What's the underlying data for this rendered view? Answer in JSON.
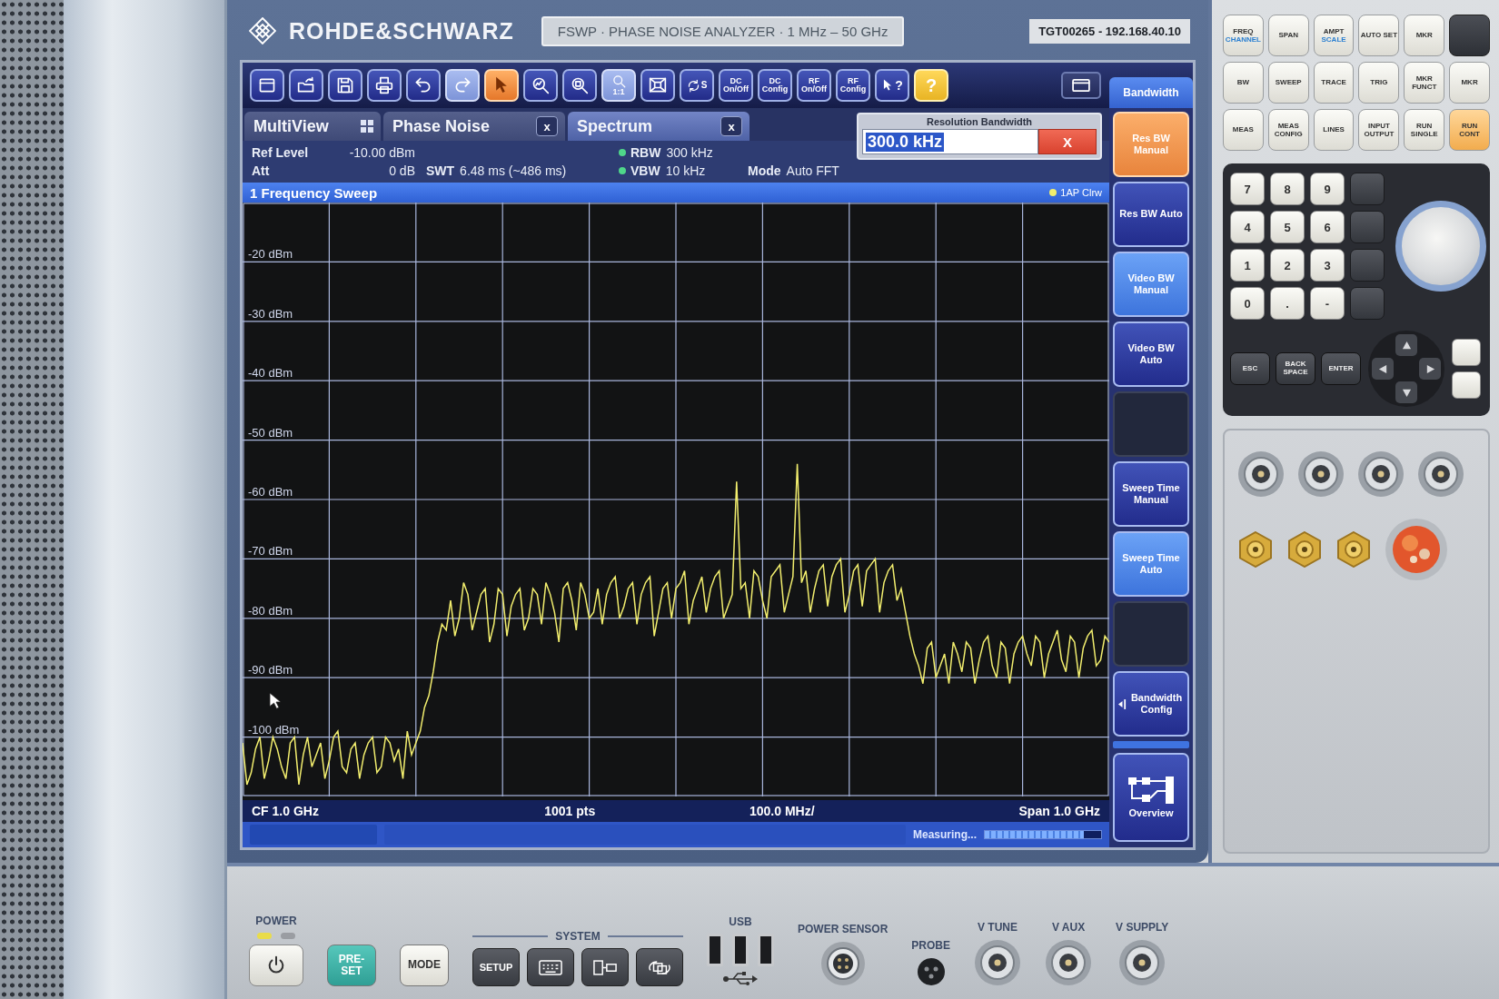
{
  "instrument": {
    "brand": "ROHDE&SCHWARZ",
    "model": "FSWP · PHASE NOISE ANALYZER · 1 MHz – 50 GHz",
    "device_id": "TGT00265 - 192.168.40.10"
  },
  "toolbar": [
    {
      "kind": "window",
      "selected": false,
      "disabled": false
    },
    {
      "kind": "open",
      "selected": false,
      "disabled": false
    },
    {
      "kind": "save",
      "selected": false,
      "disabled": false
    },
    {
      "kind": "print",
      "selected": false,
      "disabled": false
    },
    {
      "kind": "undo",
      "selected": false,
      "disabled": false
    },
    {
      "kind": "redo",
      "selected": false,
      "disabled": true
    },
    {
      "kind": "pointer",
      "selected": true,
      "disabled": false
    },
    {
      "kind": "zoom",
      "selected": false,
      "disabled": false
    },
    {
      "kind": "multizoom",
      "selected": false,
      "disabled": false
    },
    {
      "kind": "zoom-off",
      "label": "1:1",
      "selected": false,
      "disabled": true
    },
    {
      "kind": "display",
      "selected": false,
      "disabled": false
    },
    {
      "kind": "sequencer",
      "label": "S",
      "selected": false,
      "disabled": false
    },
    {
      "kind": "text",
      "label": "DC On/Off",
      "selected": false,
      "disabled": false
    },
    {
      "kind": "text",
      "label": "DC Config",
      "selected": false,
      "disabled": false
    },
    {
      "kind": "text",
      "label": "RF On/Off",
      "selected": false,
      "disabled": false
    },
    {
      "kind": "text",
      "label": "RF Config",
      "selected": false,
      "disabled": false
    },
    {
      "kind": "whatsthis",
      "label": "?",
      "selected": false,
      "disabled": false
    },
    {
      "kind": "help",
      "label": "?",
      "selected": false,
      "disabled": false
    }
  ],
  "menu": {
    "title": "Bandwidth"
  },
  "tabs": [
    {
      "kind": "multiview",
      "label": "MultiView",
      "selected": false
    },
    {
      "kind": "channel",
      "label": "Phase Noise",
      "close": "x",
      "selected": false
    },
    {
      "kind": "channel",
      "label": "Spectrum",
      "close": "x",
      "selected": true
    }
  ],
  "dialog": {
    "title": "Resolution Bandwidth",
    "value": "300.0 kHz",
    "selected": true,
    "close": "X"
  },
  "settings": [
    {
      "label": "Ref Level",
      "value": "-10.00 dBm",
      "dot": false
    },
    {
      "label": "RBW",
      "value": "300 kHz",
      "dot": true
    },
    {
      "label": "Att",
      "value": "0 dB",
      "dot": false
    },
    {
      "label": "SWT",
      "value": "6.48 ms (~486 ms)",
      "dot": false
    },
    {
      "label": "VBW",
      "value": "10 kHz",
      "dot": true
    },
    {
      "label": "Mode",
      "value": "Auto FFT",
      "dot": false
    }
  ],
  "diagram": {
    "chart_data": {
      "type": "line",
      "title": "1 Frequency Sweep",
      "grid": true,
      "categories": [
        null,
        null,
        null,
        null,
        null,
        null,
        null,
        null,
        null,
        null,
        null,
        null,
        null,
        null,
        null,
        null,
        null,
        null,
        null,
        null,
        null,
        null,
        null,
        null,
        null,
        null,
        null,
        null,
        null,
        null,
        null,
        null,
        null,
        null,
        null,
        null,
        null,
        null,
        null,
        null,
        null,
        null,
        null,
        null,
        null,
        null,
        null,
        null,
        null,
        null,
        null,
        null,
        null,
        null,
        null,
        null,
        null,
        null,
        null,
        null,
        null,
        null,
        null,
        null,
        null,
        null,
        null,
        null,
        null,
        null,
        null,
        null,
        null,
        null,
        null,
        null,
        null,
        null,
        null,
        null,
        null,
        null,
        null,
        null,
        null,
        null,
        null,
        null,
        null,
        null,
        null,
        null,
        null,
        null,
        null,
        null,
        null,
        null,
        null,
        null,
        null,
        null,
        null,
        null,
        null,
        null,
        null,
        null,
        null,
        null,
        null,
        null,
        null,
        null,
        null,
        null,
        null,
        null,
        null,
        null,
        null,
        null,
        null,
        null,
        null,
        null,
        null,
        null,
        null,
        null,
        null,
        null,
        null,
        null,
        null,
        null,
        null,
        null,
        null,
        null,
        null,
        null,
        null,
        null,
        null,
        null,
        null,
        null,
        null,
        null,
        null,
        null,
        null,
        null,
        null,
        null,
        null,
        null,
        null,
        null,
        null,
        null,
        null,
        null,
        null,
        null,
        null,
        null,
        null,
        null,
        null,
        null,
        null,
        null,
        null,
        null,
        null,
        null,
        null,
        null,
        null,
        null,
        null,
        null,
        null,
        null,
        null,
        null,
        null,
        null,
        null,
        null,
        null,
        null,
        null,
        null,
        null,
        null,
        null,
        null,
        null
      ],
      "series": [
        {
          "name": "1AP Clrw",
          "color": "#f2ee6e",
          "values": [
            -101,
            -108,
            -106,
            -102,
            -100,
            -107,
            -104,
            -100,
            -102,
            -105,
            -107,
            -101,
            -100,
            -108,
            -103,
            -100,
            -105,
            -103,
            -101,
            -107,
            -104,
            -100,
            -99,
            -105,
            -106,
            -102,
            -101,
            -107,
            -103,
            -101,
            -100,
            -106,
            -105,
            -100,
            -101,
            -104,
            -102,
            -107,
            -99,
            -103,
            -101,
            -99,
            -95,
            -93,
            -89,
            -84,
            -81,
            -82,
            -77,
            -83,
            -80,
            -74,
            -76,
            -82,
            -79,
            -76,
            -75,
            -84,
            -81,
            -75,
            -76,
            -83,
            -78,
            -76,
            -75,
            -82,
            -80,
            -75,
            -76,
            -81,
            -74,
            -76,
            -79,
            -84,
            -75,
            -74,
            -77,
            -82,
            -74,
            -76,
            -80,
            -79,
            -75,
            -81,
            -76,
            -74,
            -73,
            -80,
            -78,
            -75,
            -74,
            -81,
            -76,
            -74,
            -73,
            -83,
            -79,
            -75,
            -74,
            -80,
            -75,
            -74,
            -72,
            -81,
            -77,
            -75,
            -73,
            -79,
            -75,
            -73,
            -72,
            -80,
            -78,
            -76,
            -57,
            -75,
            -74,
            -80,
            -72,
            -73,
            -77,
            -80,
            -73,
            -72,
            -71,
            -79,
            -76,
            -73,
            -54,
            -74,
            -72,
            -79,
            -75,
            -72,
            -71,
            -78,
            -73,
            -71,
            -70,
            -79,
            -76,
            -72,
            -71,
            -78,
            -72,
            -71,
            -70,
            -79,
            -74,
            -72,
            -71,
            -77,
            -75,
            -79,
            -83,
            -86,
            -88,
            -91,
            -85,
            -84,
            -90,
            -88,
            -86,
            -91,
            -84,
            -86,
            -89,
            -84,
            -85,
            -91,
            -87,
            -84,
            -83,
            -88,
            -90,
            -84,
            -85,
            -91,
            -86,
            -84,
            -83,
            -86,
            -88,
            -83,
            -84,
            -90,
            -86,
            -84,
            -82,
            -87,
            -89,
            -83,
            -84,
            -90,
            -85,
            -83,
            -82,
            -88,
            -87,
            -83,
            -84
          ]
        }
      ],
      "ylim": [
        -110,
        -10
      ],
      "yticks": [
        {
          "value": -20,
          "label": "-20 dBm"
        },
        {
          "value": -30,
          "label": "-30 dBm"
        },
        {
          "value": -40,
          "label": "-40 dBm"
        },
        {
          "value": -50,
          "label": "-50 dBm"
        },
        {
          "value": -60,
          "label": "-60 dBm"
        },
        {
          "value": -70,
          "label": "-70 dBm"
        },
        {
          "value": -80,
          "label": "-80 dBm"
        },
        {
          "value": -90,
          "label": "-90 dBm"
        },
        {
          "value": -100,
          "label": "-100 dBm"
        }
      ]
    },
    "footer": {
      "center": "CF 1.0 GHz",
      "points": "1001 pts",
      "scale": "100.0 MHz/",
      "span": "Span 1.0 GHz"
    }
  },
  "status": {
    "message": "Measuring...",
    "level": 0.85
  },
  "softkeys": [
    {
      "kind": "key",
      "label": "Res BW Manual",
      "selected": true,
      "on": false
    },
    {
      "kind": "key",
      "label": "Res BW Auto",
      "selected": false,
      "on": false
    },
    {
      "kind": "key",
      "label": "Video BW Manual",
      "selected": false,
      "on": true
    },
    {
      "kind": "key",
      "label": "Video BW Auto",
      "selected": false,
      "on": false
    },
    {
      "kind": "blank",
      "selected": false,
      "on": false
    },
    {
      "kind": "key",
      "label": "Sweep Time Manual",
      "selected": false,
      "on": false
    },
    {
      "kind": "key",
      "label": "Sweep Time Auto",
      "selected": false,
      "on": true
    },
    {
      "kind": "blank",
      "selected": false,
      "on": false
    },
    {
      "kind": "submenu",
      "label": "Bandwidth Config",
      "selected": false,
      "on": false
    },
    {
      "kind": "overview",
      "label": "Overview",
      "selected": false,
      "on": false
    }
  ],
  "hardkeys": [
    {
      "kind": "light",
      "label": "FREQ",
      "sub": "CHANNEL",
      "on": false
    },
    {
      "kind": "light",
      "label": "SPAN",
      "on": false
    },
    {
      "kind": "light",
      "label": "AMPT",
      "sub": "SCALE",
      "on": false
    },
    {
      "kind": "light",
      "label": "AUTO SET",
      "on": false
    },
    {
      "kind": "light",
      "label": "MKR",
      "on": false
    },
    {
      "kind": "dark",
      "on": false
    },
    {
      "kind": "light",
      "label": "BW",
      "on": false
    },
    {
      "kind": "light",
      "label": "SWEEP",
      "on": false
    },
    {
      "kind": "light",
      "label": "TRACE",
      "on": false
    },
    {
      "kind": "light",
      "label": "TRIG",
      "on": false
    },
    {
      "kind": "light",
      "label": "MKR FUNCT",
      "on": false
    },
    {
      "kind": "light",
      "label": "MKR",
      "on": false
    },
    {
      "kind": "light",
      "label": "MEAS",
      "on": false
    },
    {
      "kind": "light",
      "label": "MEAS CONFIG",
      "on": false
    },
    {
      "kind": "light",
      "label": "LINES",
      "on": false
    },
    {
      "kind": "light",
      "label": "INPUT OUTPUT",
      "on": false
    },
    {
      "kind": "light",
      "label": "RUN SINGLE",
      "on": false
    },
    {
      "kind": "light",
      "label": "RUN CONT",
      "on": true
    }
  ],
  "keypad": [
    "7",
    "8",
    "9",
    "4",
    "5",
    "6",
    "1",
    "2",
    "3",
    "0",
    ".",
    "-"
  ],
  "edit_keys": [
    "ESC",
    "BACK SPACE",
    "ENTER"
  ],
  "power": {
    "label": "POWER",
    "leds": [
      {
        "on": true
      },
      {
        "on": false
      }
    ]
  },
  "front_keys": [
    {
      "kind": "preset",
      "label": "PRE-SET"
    },
    {
      "kind": "mode",
      "label": "MODE"
    }
  ],
  "system": {
    "label": "SYSTEM",
    "keys": [
      {
        "kind": "setup",
        "label": "SETUP"
      },
      {
        "kind": "keyboard"
      },
      {
        "kind": "split"
      },
      {
        "kind": "switch"
      }
    ]
  },
  "ports": [
    {
      "kind": "usb",
      "label": "USB"
    },
    {
      "kind": "sensor",
      "label": "POWER SENSOR"
    },
    {
      "kind": "probe",
      "label": "PROBE"
    },
    {
      "kind": "bnc",
      "label": "V TUNE"
    },
    {
      "kind": "bnc",
      "label": "V AUX"
    },
    {
      "kind": "bnc",
      "label": "V SUPPLY"
    }
  ]
}
